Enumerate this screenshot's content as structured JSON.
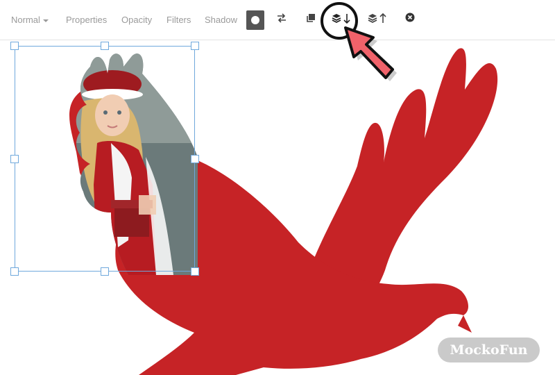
{
  "toolbar": {
    "normal_label": "Normal",
    "properties_label": "Properties",
    "opacity_label": "Opacity",
    "filters_label": "Filters",
    "shadow_label": "Shadow",
    "icons": [
      "circle-mask-icon",
      "swap-icon",
      "duplicate-icon",
      "send-backward-icon",
      "bring-forward-icon",
      "delete-icon"
    ]
  },
  "canvas": {
    "shape_color": "#c62326",
    "selection_color": "#6fa8dc"
  },
  "annotation": {
    "ring_color": "#111111",
    "arrow_color": "#f0626a"
  },
  "watermark": {
    "text": "MockoFun"
  }
}
